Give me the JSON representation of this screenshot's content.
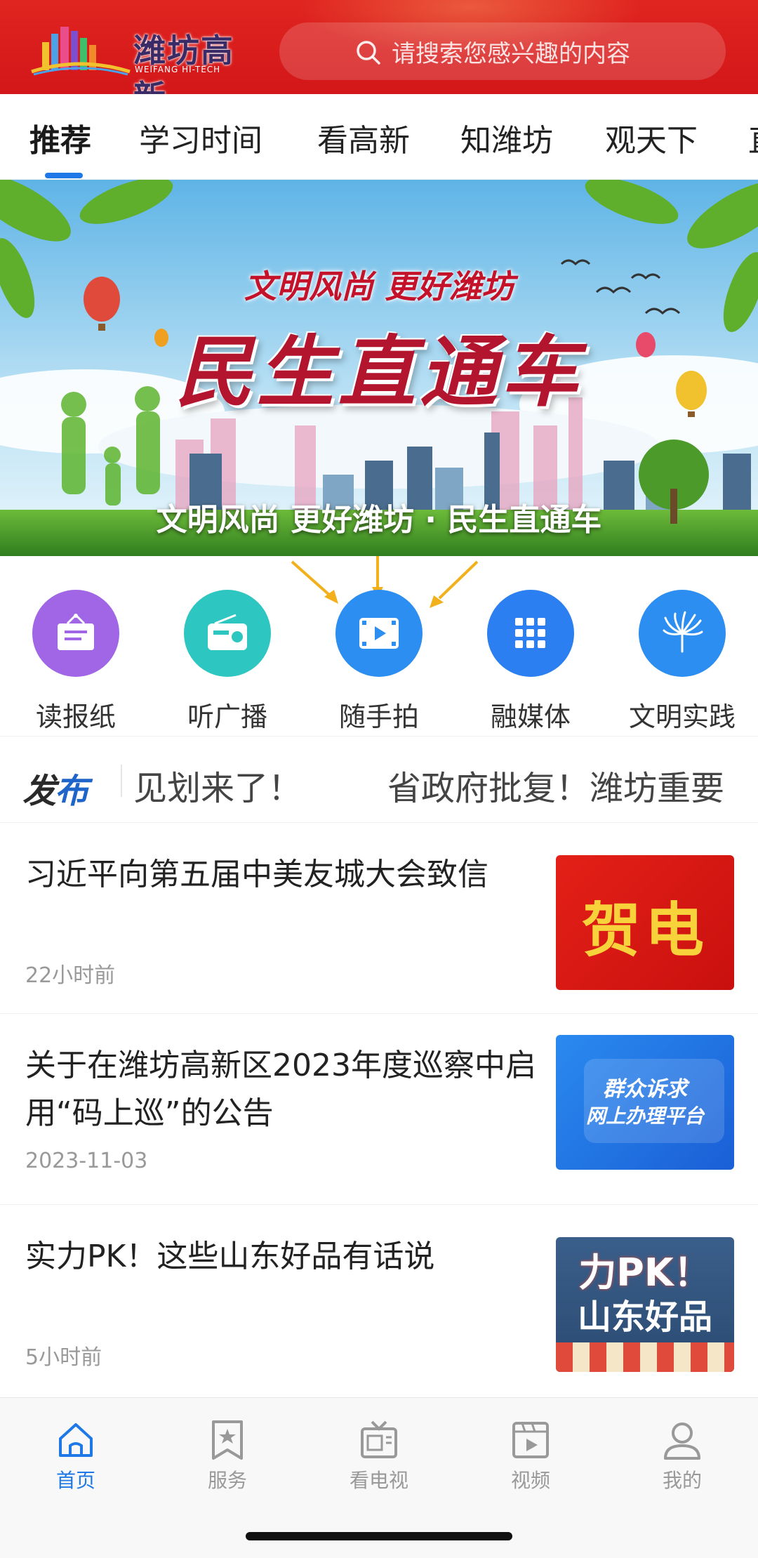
{
  "header": {
    "logo_title": "潍坊高新",
    "logo_sub": "WEIFANG HI-TECH",
    "search_placeholder": "请搜索您感兴趣的内容"
  },
  "tabs": [
    {
      "label": "推荐",
      "active": true
    },
    {
      "label": "学习时间",
      "active": false
    },
    {
      "label": "看高新",
      "active": false
    },
    {
      "label": "知潍坊",
      "active": false
    },
    {
      "label": "观天下",
      "active": false
    },
    {
      "label": "直",
      "active": false
    }
  ],
  "banner": {
    "slogan": "文明风尚 更好潍坊",
    "title": "民生直通车",
    "caption": "文明风尚 更好潍坊 · 民生直通车"
  },
  "quick_menu": [
    {
      "label": "读报纸",
      "icon": "newspaper-icon",
      "color": "#a066e6"
    },
    {
      "label": "听广播",
      "icon": "radio-icon",
      "color": "#2ec6c0"
    },
    {
      "label": "随手拍",
      "icon": "video-icon",
      "color": "#2b8ef0"
    },
    {
      "label": "融媒体",
      "icon": "grid-icon",
      "color": "#2b7ff0"
    },
    {
      "label": "文明实践",
      "icon": "fan-icon",
      "color": "#2b8ef0"
    }
  ],
  "ticker": {
    "logo_a": "发",
    "logo_b": "布",
    "items": [
      "见划来了！",
      "省政府批复！潍坊重要"
    ]
  },
  "news": [
    {
      "title": "习近平向第五届中美友城大会致信",
      "time": "22小时前",
      "thumb_text": "贺电"
    },
    {
      "title": "关于在潍坊高新区2023年度巡察中启用“码上巡”的公告",
      "time": "2023-11-03",
      "thumb_text_1": "群众诉求",
      "thumb_text_2": "网上办理平台"
    },
    {
      "title": "实力PK！这些山东好品有话说",
      "time": "5小时前",
      "thumb_text_1": "力PK！",
      "thumb_text_2": "山东好品"
    }
  ],
  "bottom_nav": [
    {
      "label": "首页",
      "icon": "home-icon",
      "active": true
    },
    {
      "label": "服务",
      "icon": "bookmark-star-icon",
      "active": false
    },
    {
      "label": "看电视",
      "icon": "tv-icon",
      "active": false
    },
    {
      "label": "视频",
      "icon": "play-video-icon",
      "active": false
    },
    {
      "label": "我的",
      "icon": "user-icon",
      "active": false
    }
  ],
  "colors": {
    "header_red": "#d3171a",
    "accent_blue": "#1f78e8"
  }
}
